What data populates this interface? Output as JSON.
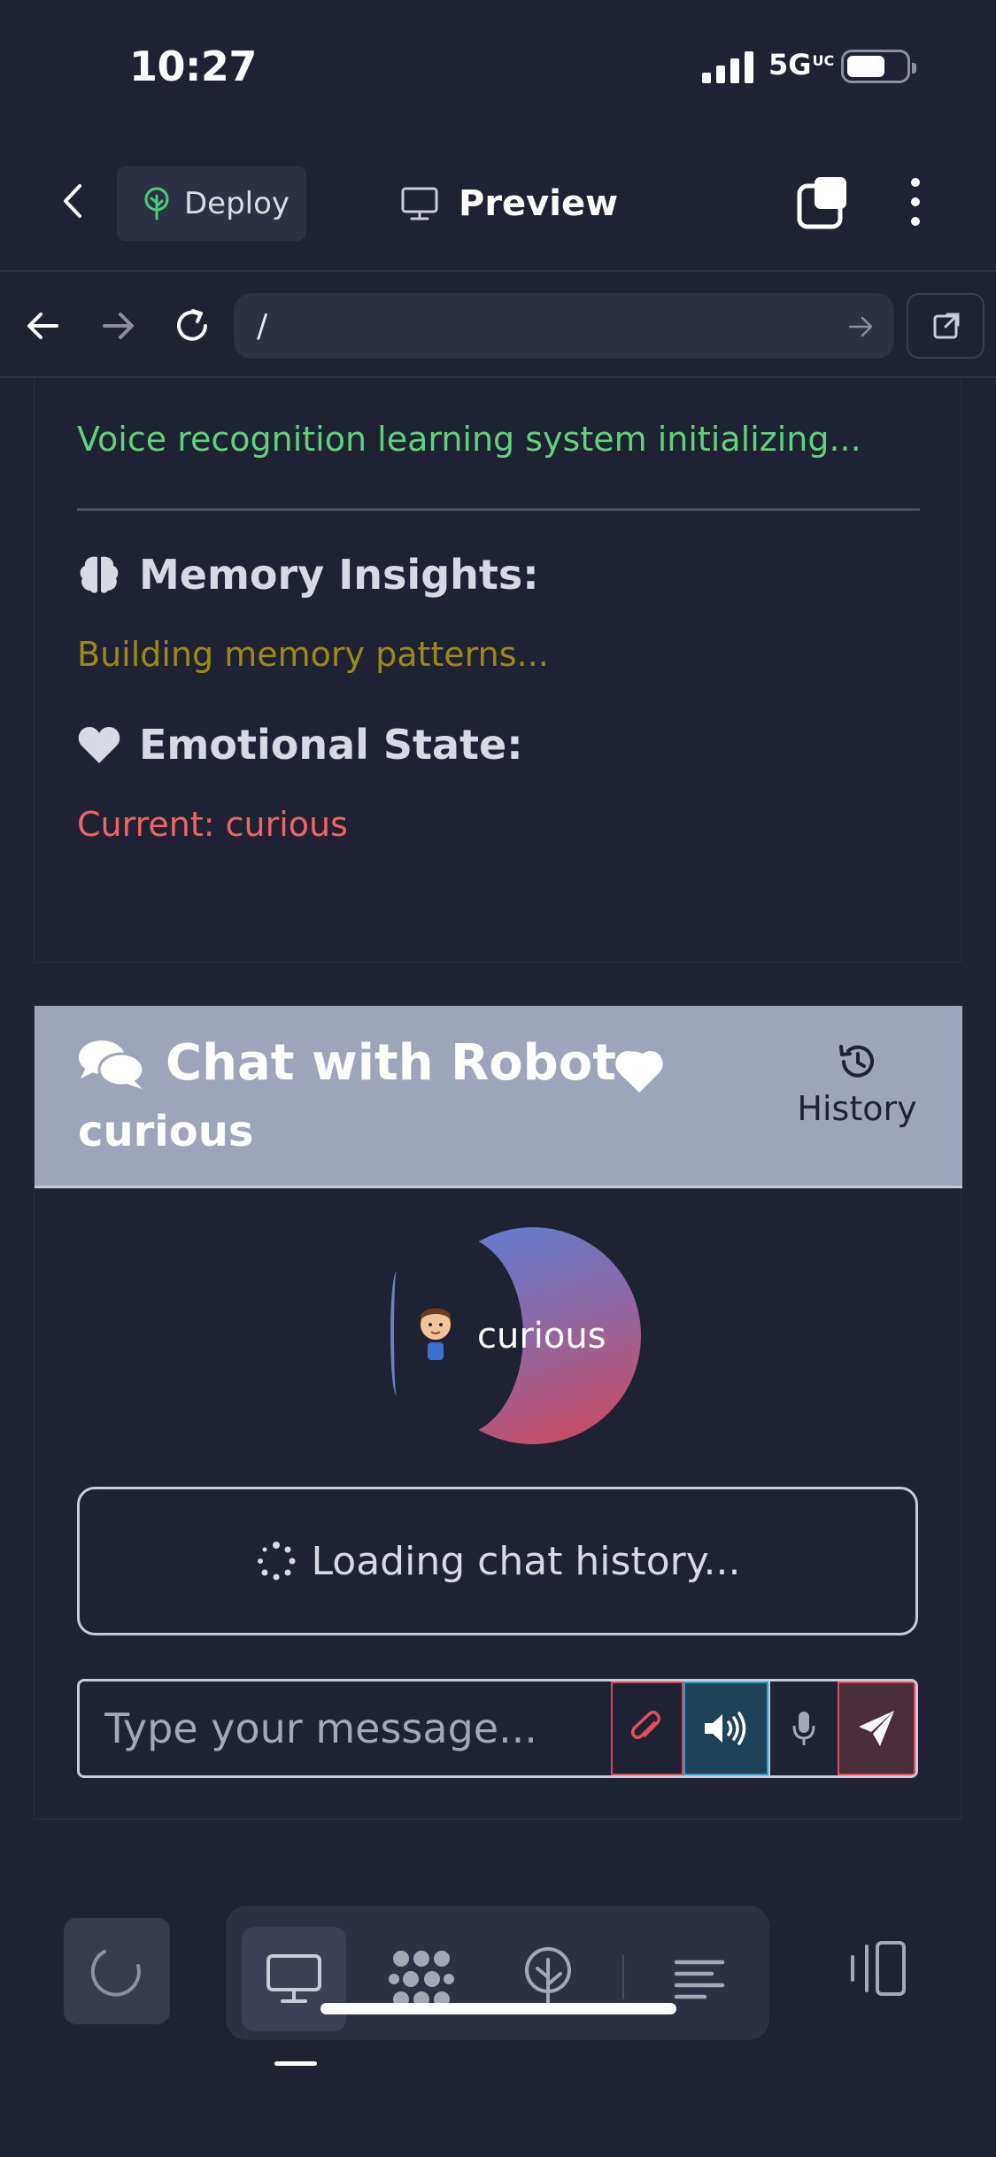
{
  "status_bar": {
    "time": "10:27",
    "network": "5G",
    "network_suffix": "UC"
  },
  "app_bar": {
    "deploy_label": "Deploy",
    "preview_label": "Preview"
  },
  "url_bar": {
    "url": "/"
  },
  "panel": {
    "voice_status": "Voice recognition learning system initializing...",
    "memory_title": "Memory Insights:",
    "memory_text": "Building memory patterns...",
    "emotion_title": "Emotional State:",
    "emotion_text": "Current: curious"
  },
  "chat": {
    "title": "Chat with Roboto",
    "emotion": "curious",
    "history_label": "History",
    "avatar_emotion": "curious",
    "loading_text": "Loading chat history...",
    "input_placeholder": "Type your message..."
  },
  "colors": {
    "background": "#1e2232",
    "voice_status": "#5fd37a",
    "memory_text": "#9c8a14",
    "emotion_text": "#ef6464",
    "chat_header": "#9ea5ba",
    "attach_border": "#d94a58",
    "speak_border": "#2ea0c8",
    "send_border": "#e0505f"
  },
  "icons": {
    "deploy": "tree-icon",
    "preview": "monitor-icon",
    "memory": "brain-icon",
    "emotion": "heart-icon",
    "chat": "comments-icon",
    "history": "history-icon",
    "attach": "paperclip-icon",
    "speak": "volume-icon",
    "mic": "microphone-icon",
    "send": "paper-plane-icon"
  }
}
